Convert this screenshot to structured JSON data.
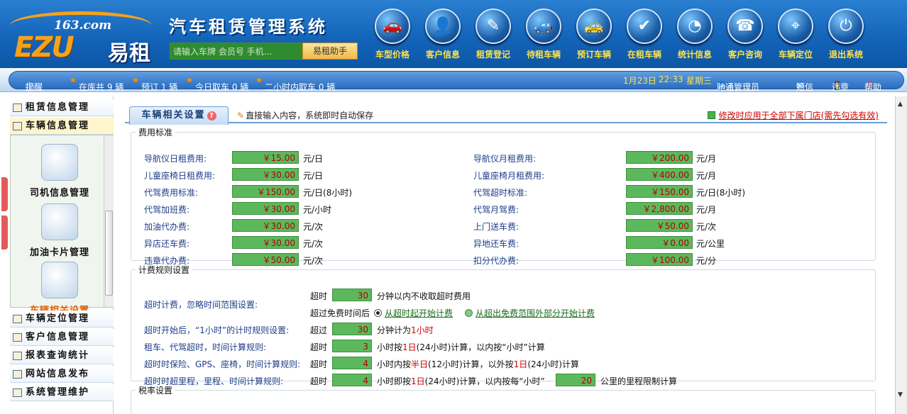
{
  "header": {
    "logo_163": "163.com",
    "logo_ezu": "EZU",
    "logo_cn": "易租",
    "title": "汽车租赁管理系统",
    "search_placeholder": "请输入车牌 会员号 手机...",
    "search_button": "易租助手",
    "nav": [
      {
        "label": "车型价格",
        "icon": "car-icon"
      },
      {
        "label": "客户信息",
        "icon": "customer-icon"
      },
      {
        "label": "租赁登记",
        "icon": "register-icon"
      },
      {
        "label": "待租车辆",
        "icon": "waiting-car-icon"
      },
      {
        "label": "预订车辆",
        "icon": "reserve-car-icon"
      },
      {
        "label": "在租车辆",
        "icon": "rented-car-icon"
      },
      {
        "label": "统计信息",
        "icon": "stats-icon"
      },
      {
        "label": "客户咨询",
        "icon": "consult-icon"
      },
      {
        "label": "车辆定位",
        "icon": "locate-icon"
      },
      {
        "label": "退出系统",
        "icon": "exit-icon"
      }
    ]
  },
  "status": {
    "reminder": "提醒",
    "in_stock": "在库共 9 辆",
    "reserved": "预订 1 辆",
    "pickup_today": "今日取车 0 辆",
    "pickup_2h": "二小时内取车 0 辆",
    "date": "1月23日",
    "time": "22:33",
    "weekday": "星期三",
    "company": "驰通",
    "user": "驰通管理员",
    "sms": "短信",
    "violation": "违章",
    "help": "帮助"
  },
  "sidebar": {
    "items_top": [
      "租赁信息管理",
      "车辆信息管理"
    ],
    "sub_items": [
      {
        "label": "司机信息管理",
        "icon": "driver-icon"
      },
      {
        "label": "加油卡片管理",
        "icon": "fuel-card-icon"
      },
      {
        "label": "车辆相关设置",
        "icon": "settings-icon"
      }
    ],
    "items_bottom": [
      "车辆定位管理",
      "客户信息管理",
      "报表查询统计",
      "网站信息发布",
      "系统管理维护"
    ]
  },
  "main": {
    "tab": "车辆相关设置",
    "autosave_note": "直接输入内容，系统即时自动保存",
    "apply_all": "修改时应用于全部下属门店(需先勾选有效)",
    "fees": {
      "legend": "费用标准",
      "left": [
        {
          "label": "导航仪日租费用:",
          "value": "￥15.00",
          "unit": "元/日"
        },
        {
          "label": "儿童座椅日租费用:",
          "value": "￥30.00",
          "unit": "元/日"
        },
        {
          "label": "代驾费用标准:",
          "value": "￥150.00",
          "unit": "元/日(8小时)"
        },
        {
          "label": "代驾加班费:",
          "value": "￥30.00",
          "unit": "元/小时"
        },
        {
          "label": "加油代办费:",
          "value": "￥30.00",
          "unit": "元/次"
        },
        {
          "label": "异店还车费:",
          "value": "￥30.00",
          "unit": "元/次"
        },
        {
          "label": "违章代办费:",
          "value": "￥50.00",
          "unit": "元/次"
        }
      ],
      "right": [
        {
          "label": "导航仪月租费用:",
          "value": "￥200.00",
          "unit": "元/月"
        },
        {
          "label": "儿童座椅月租费用:",
          "value": "￥400.00",
          "unit": "元/月"
        },
        {
          "label": "代驾超时标准:",
          "value": "￥150.00",
          "unit": "元/日(8小时)"
        },
        {
          "label": "代驾月驾费:",
          "value": "￥2,800.00",
          "unit": "元/月"
        },
        {
          "label": "上门送车费:",
          "value": "￥50.00",
          "unit": "元/次"
        },
        {
          "label": "异地还车费:",
          "value": "￥0.00",
          "unit": "元/公里"
        },
        {
          "label": "扣分代办费:",
          "value": "￥100.00",
          "unit": "元/分"
        }
      ]
    },
    "rules": {
      "legend": "计费规则设置",
      "r1_label": "超时计费，忽略时间范围设置:",
      "r1_a": "超时",
      "r1_val": "30",
      "r1_b": "分钟以内不收取超时费用",
      "r1_c": "超过免费时间后",
      "r1_opt1": "从超时起开始计费",
      "r1_opt2": "从超出免费范围外部分开始计费",
      "r2_label": "超时开始后，“1小时”的计时规则设置:",
      "r2_a": "超过",
      "r2_val": "30",
      "r2_b": "分钟计为",
      "r2_c": "1小时",
      "r3_label": "租车、代驾超时，时间计算规则:",
      "r3_a": "超时",
      "r3_val": "3",
      "r3_b1": "小时按",
      "r3_b2": "1日",
      "r3_b3": "(24小时)计算，以内按“小时”计算",
      "r4_label": "超时时保险、GPS、座椅，时间计算规则:",
      "r4_a": "超时",
      "r4_val": "4",
      "r4_b1": "小时内按",
      "r4_b2": "半日",
      "r4_b3": "(12小时)计算，以外按",
      "r4_b4": "1日",
      "r4_b5": "(24小时)计算",
      "r5_label": "超时时超里程，里程、时间计算规则:",
      "r5_a": "超时",
      "r5_val": "4",
      "r5_b1": "小时即按",
      "r5_b2": "1日",
      "r5_b3": "(24小时)计算，以内按每“小时”",
      "r5_val2": "20",
      "r5_c": "公里的里程限制计算"
    },
    "tax": {
      "legend": "税率设置"
    }
  },
  "colors": {
    "field_green": "#5cb85c",
    "value_red": "#b20000",
    "label_blue": "#1e3d8a",
    "accent_yellow": "#ffe24a"
  }
}
